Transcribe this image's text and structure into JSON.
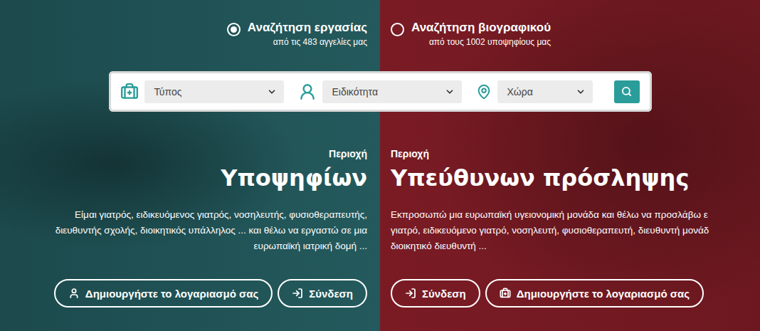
{
  "search_modes": [
    {
      "label": "Αναζήτηση εργασίας",
      "subtitle": "από τις 483 αγγελίες μας",
      "selected": true
    },
    {
      "label": "Αναζήτηση βιογραφικού",
      "subtitle": "από τους 1002 υποψηφίους μας",
      "selected": false
    }
  ],
  "search_bar": {
    "filters": [
      {
        "kind": "type",
        "placeholder": "Τύπος"
      },
      {
        "kind": "specialty",
        "placeholder": "Ειδικότητα"
      },
      {
        "kind": "country",
        "placeholder": "Χώρα"
      }
    ]
  },
  "areas": [
    {
      "kind": "candidates",
      "kicker": "Περιοχή",
      "title": "Υποψηφίων",
      "description": [
        "Είμαι γιατρός, ειδικευόμενος γιατρός, νοσηλευτής, φυσιοθεραπευτής,",
        "διευθυντής σχολής, διοικητικός υπάλληλος ... και θέλω να εργαστώ σε μια",
        "ευρωπαϊκή ιατρική δομή ..."
      ],
      "buttons": [
        {
          "kind": "register",
          "label": "Δημιουργήστε το λογαριασμό σας"
        },
        {
          "kind": "login",
          "label": "Σύνδεση"
        }
      ]
    },
    {
      "kind": "recruiters",
      "kicker": "Περιοχή",
      "title": "Υπεύθυνων πρόσληψης",
      "description": [
        "Εκπροσωπώ μια ευρωπαϊκή υγειονομική μονάδα και θέλω να προσλάβω ε",
        "γιατρό, ειδικευόμενο γιατρό, νοσηλευτή, φυσιοθεραπευτή, διευθυντή μονάδ",
        "διοικητικό διευθυντή ..."
      ],
      "buttons": [
        {
          "kind": "login",
          "label": "Σύνδεση"
        },
        {
          "kind": "register",
          "label": "Δημιουργήστε το λογαριασμό σας"
        }
      ]
    }
  ]
}
